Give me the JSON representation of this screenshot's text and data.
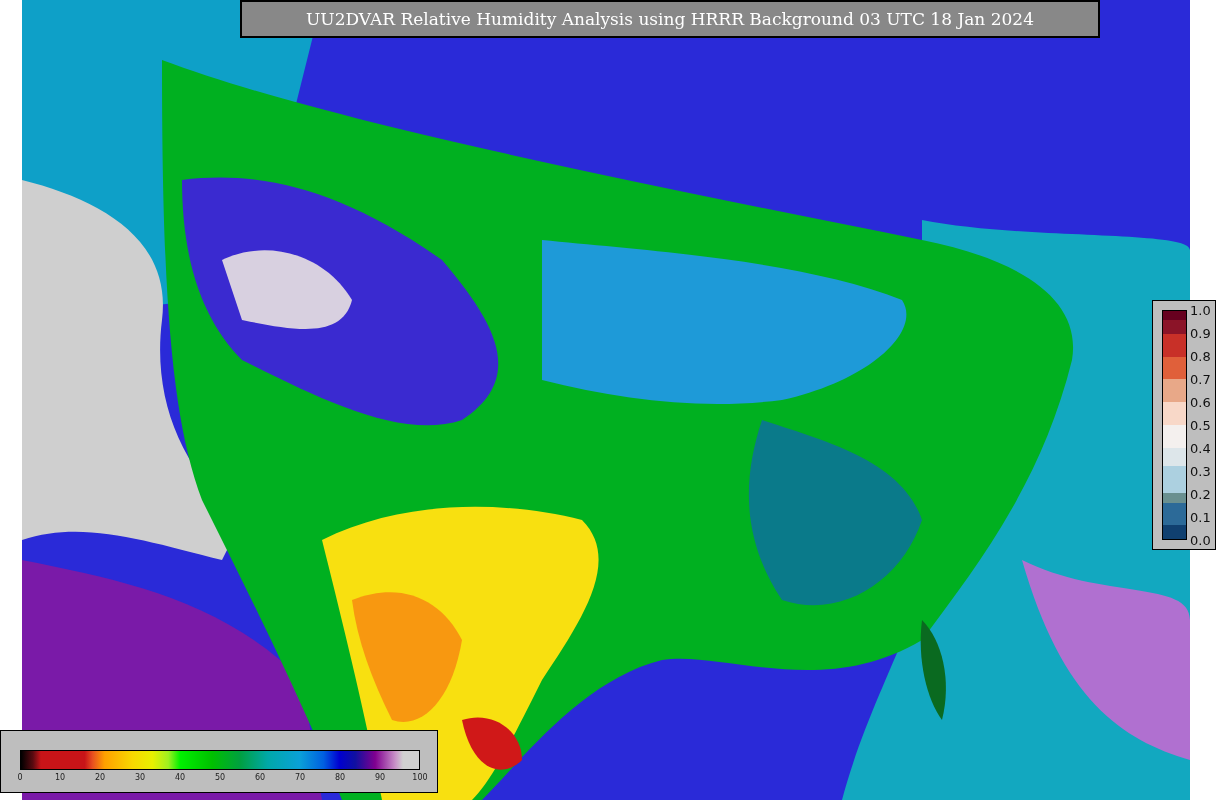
{
  "title": "UU2DVAR Relative Humidity Analysis using HRRR Background 03 UTC 18 Jan 2024",
  "humidity_colorbar": {
    "ticks": [
      "0",
      "10",
      "20",
      "30",
      "40",
      "50",
      "60",
      "70",
      "80",
      "90",
      "100"
    ]
  },
  "fraction_colorbar": {
    "ticks": [
      "1.0",
      "0.9",
      "0.8",
      "0.7",
      "0.6",
      "0.5",
      "0.4",
      "0.3",
      "0.2",
      "0.1",
      "0.0"
    ]
  }
}
